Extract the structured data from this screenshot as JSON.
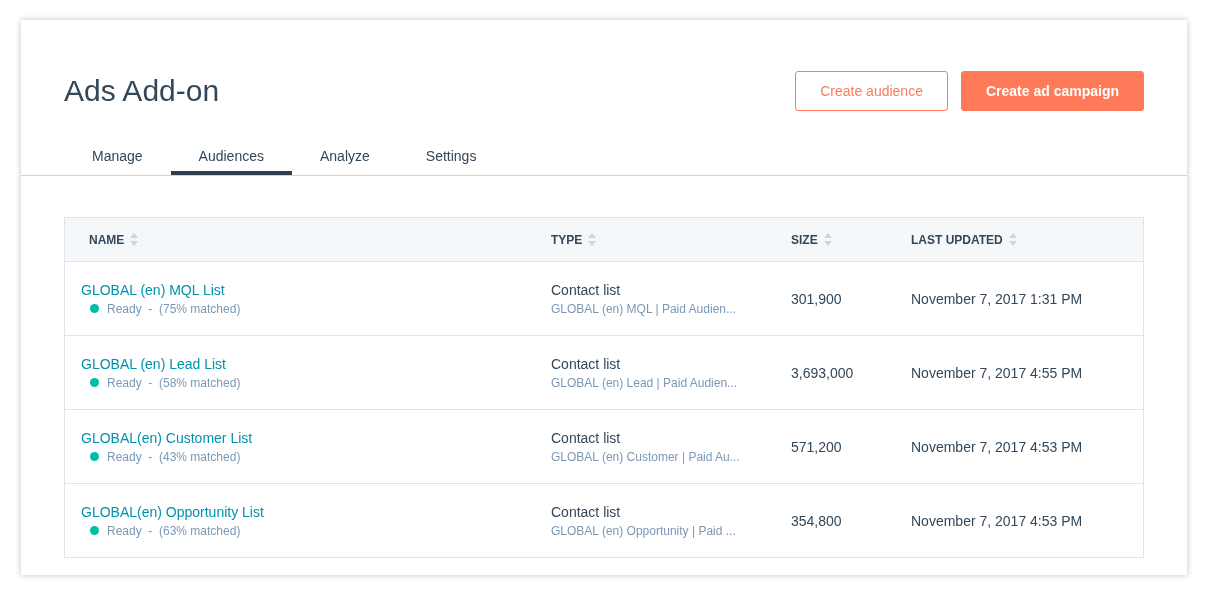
{
  "header": {
    "title": "Ads Add-on",
    "buttons": [
      {
        "label": "Create audience",
        "kind": "secondary"
      },
      {
        "label": "Create ad campaign",
        "kind": "primary"
      }
    ]
  },
  "tabs": [
    {
      "label": "Manage",
      "selected": false
    },
    {
      "label": "Audiences",
      "selected": true
    },
    {
      "label": "Analyze",
      "selected": false
    },
    {
      "label": "Settings",
      "selected": false
    }
  ],
  "table": {
    "columns": [
      "NAME",
      "TYPE",
      "SIZE",
      "LAST UPDATED"
    ],
    "rows": [
      {
        "name": "GLOBAL (en) MQL List",
        "status": "Ready  -  (75% matched)",
        "color": "#00bda5",
        "type": "Contact list",
        "source": "GLOBAL (en) MQL | Paid Audien...",
        "size": "301,900",
        "updated": "November 7, 2017 1:31 PM"
      },
      {
        "name": "GLOBAL (en) Lead List",
        "status": "Ready  -  (58% matched)",
        "color": "#00bda5",
        "type": "Contact list",
        "source": "GLOBAL (en) Lead | Paid Audien...",
        "size": "3,693,000",
        "updated": "November 7, 2017 4:55 PM"
      },
      {
        "name": "GLOBAL(en) Customer List",
        "status": "Ready  -  (43% matched)",
        "color": "#00bda5",
        "type": "Contact list",
        "source": "GLOBAL (en) Customer | Paid Au...",
        "size": "571,200",
        "updated": "November 7, 2017 4:53 PM"
      },
      {
        "name": "GLOBAL(en) Opportunity List",
        "status": "Ready  -  (63% matched)",
        "color": "#00bda5",
        "type": "Contact list",
        "source": "GLOBAL (en) Opportunity | Paid ...",
        "size": "354,800",
        "updated": "November 7, 2017 4:53 PM"
      }
    ]
  }
}
